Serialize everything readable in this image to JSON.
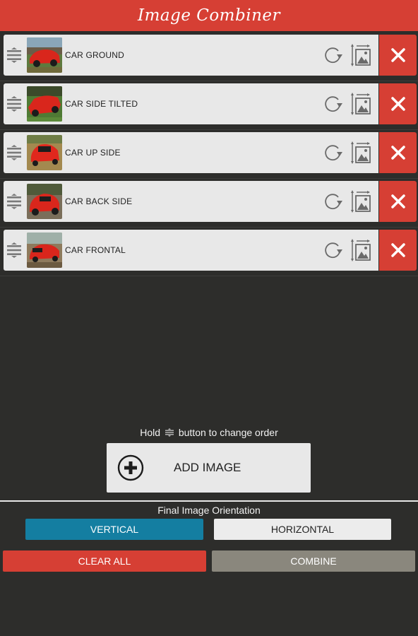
{
  "app": {
    "title": "Image Combiner"
  },
  "images": [
    {
      "label": "CAR GROUND"
    },
    {
      "label": "CAR SIDE TILTED"
    },
    {
      "label": "CAR UP SIDE"
    },
    {
      "label": "CAR BACK SIDE"
    },
    {
      "label": "CAR FRONTAL"
    }
  ],
  "hint": {
    "prefix": "Hold",
    "suffix": "button to change order"
  },
  "add_button": {
    "label": "ADD IMAGE"
  },
  "orientation": {
    "label": "Final Image Orientation",
    "vertical": "VERTICAL",
    "horizontal": "HORIZONTAL",
    "selected": "VERTICAL"
  },
  "actions": {
    "clear_all": "CLEAR ALL",
    "combine": "COMBINE"
  },
  "icons": {
    "handle": "drag-handle-icon",
    "rotate": "rotate-icon",
    "resize": "image-resize-icon",
    "delete": "close-icon",
    "add": "plus-circle-icon"
  },
  "colors": {
    "accent_red": "#d63f34",
    "selected_blue": "#147ea1",
    "combine_gray": "#8a877d",
    "background": "#2d2d2b"
  }
}
